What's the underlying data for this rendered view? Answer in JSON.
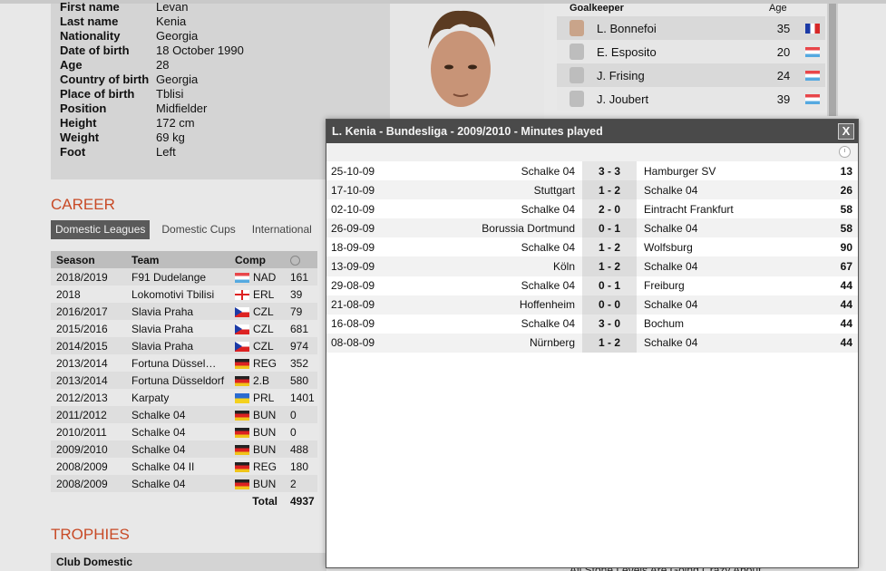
{
  "player": {
    "rows": [
      {
        "k": "First name",
        "v": "Levan"
      },
      {
        "k": "Last name",
        "v": "Kenia"
      },
      {
        "k": "Nationality",
        "v": "Georgia"
      },
      {
        "k": "Date of birth",
        "v": "18 October 1990"
      },
      {
        "k": "Age",
        "v": "28"
      },
      {
        "k": "Country of birth",
        "v": "Georgia"
      },
      {
        "k": "Place of birth",
        "v": "Tblisi"
      },
      {
        "k": "Position",
        "v": "Midfielder"
      },
      {
        "k": "Height",
        "v": "172 cm"
      },
      {
        "k": "Weight",
        "v": "69 kg"
      },
      {
        "k": "Foot",
        "v": "Left"
      }
    ]
  },
  "goalkeepers": {
    "title": "Goalkeeper",
    "age_header": "Age",
    "rows": [
      {
        "name": "L. Bonnefoi",
        "age": "35",
        "flag": "flag-fr",
        "avatar": "face"
      },
      {
        "name": "E. Esposito",
        "age": "20",
        "flag": "flag-lu",
        "avatar": "silhouette"
      },
      {
        "name": "J. Frising",
        "age": "24",
        "flag": "flag-lu",
        "avatar": "silhouette"
      },
      {
        "name": "J. Joubert",
        "age": "39",
        "flag": "flag-lu",
        "avatar": "silhouette"
      }
    ]
  },
  "career": {
    "title": "CAREER",
    "tabs": [
      "Domestic Leagues",
      "Domestic Cups",
      "International"
    ],
    "headers": {
      "season": "Season",
      "team": "Team",
      "comp": "Comp"
    },
    "rows": [
      {
        "season": "2018/2019",
        "team": "F91 Dudelange",
        "flag": "flag-lu",
        "comp": "NAD",
        "mins": "161"
      },
      {
        "season": "2018",
        "team": "Lokomotivi Tbilisi",
        "flag": "flag-ge",
        "comp": "ERL",
        "mins": "39"
      },
      {
        "season": "2016/2017",
        "team": "Slavia Praha",
        "flag": "flag-cz",
        "comp": "CZL",
        "mins": "79"
      },
      {
        "season": "2015/2016",
        "team": "Slavia Praha",
        "flag": "flag-cz",
        "comp": "CZL",
        "mins": "681"
      },
      {
        "season": "2014/2015",
        "team": "Slavia Praha",
        "flag": "flag-cz",
        "comp": "CZL",
        "mins": "974"
      },
      {
        "season": "2013/2014",
        "team": "Fortuna Düssel…",
        "flag": "flag-de",
        "comp": "REG",
        "mins": "352"
      },
      {
        "season": "2013/2014",
        "team": "Fortuna Düsseldorf",
        "flag": "flag-de",
        "comp": "2.B",
        "mins": "580"
      },
      {
        "season": "2012/2013",
        "team": "Karpaty",
        "flag": "flag-ua",
        "comp": "PRL",
        "mins": "1401"
      },
      {
        "season": "2011/2012",
        "team": "Schalke 04",
        "flag": "flag-de",
        "comp": "BUN",
        "mins": "0"
      },
      {
        "season": "2010/2011",
        "team": "Schalke 04",
        "flag": "flag-de",
        "comp": "BUN",
        "mins": "0"
      },
      {
        "season": "2009/2010",
        "team": "Schalke 04",
        "flag": "flag-de",
        "comp": "BUN",
        "mins": "488"
      },
      {
        "season": "2008/2009",
        "team": "Schalke 04 II",
        "flag": "flag-de",
        "comp": "REG",
        "mins": "180"
      },
      {
        "season": "2008/2009",
        "team": "Schalke 04",
        "flag": "flag-de",
        "comp": "BUN",
        "mins": "2"
      }
    ],
    "total_label": "Total",
    "total_value": "4937"
  },
  "trophies": {
    "title": "TROPHIES",
    "club_domestic": "Club Domestic"
  },
  "ticker": "All Stone Levels Are Going Crazy About",
  "modal": {
    "title": "L. Kenia - Bundesliga - 2009/2010 - Minutes played",
    "close_label": "X",
    "matches": [
      {
        "date": "25-10-09",
        "home": "Schalke 04",
        "score": "3 - 3",
        "away": "Hamburger SV",
        "mins": "13"
      },
      {
        "date": "17-10-09",
        "home": "Stuttgart",
        "score": "1 - 2",
        "away": "Schalke 04",
        "mins": "26"
      },
      {
        "date": "02-10-09",
        "home": "Schalke 04",
        "score": "2 - 0",
        "away": "Eintracht Frankfurt",
        "mins": "58"
      },
      {
        "date": "26-09-09",
        "home": "Borussia Dortmund",
        "score": "0 - 1",
        "away": "Schalke 04",
        "mins": "58"
      },
      {
        "date": "18-09-09",
        "home": "Schalke 04",
        "score": "1 - 2",
        "away": "Wolfsburg",
        "mins": "90"
      },
      {
        "date": "13-09-09",
        "home": "Köln",
        "score": "1 - 2",
        "away": "Schalke 04",
        "mins": "67"
      },
      {
        "date": "29-08-09",
        "home": "Schalke 04",
        "score": "0 - 1",
        "away": "Freiburg",
        "mins": "44"
      },
      {
        "date": "21-08-09",
        "home": "Hoffenheim",
        "score": "0 - 0",
        "away": "Schalke 04",
        "mins": "44"
      },
      {
        "date": "16-08-09",
        "home": "Schalke 04",
        "score": "3 - 0",
        "away": "Bochum",
        "mins": "44"
      },
      {
        "date": "08-08-09",
        "home": "Nürnberg",
        "score": "1 - 2",
        "away": "Schalke 04",
        "mins": "44"
      }
    ]
  }
}
